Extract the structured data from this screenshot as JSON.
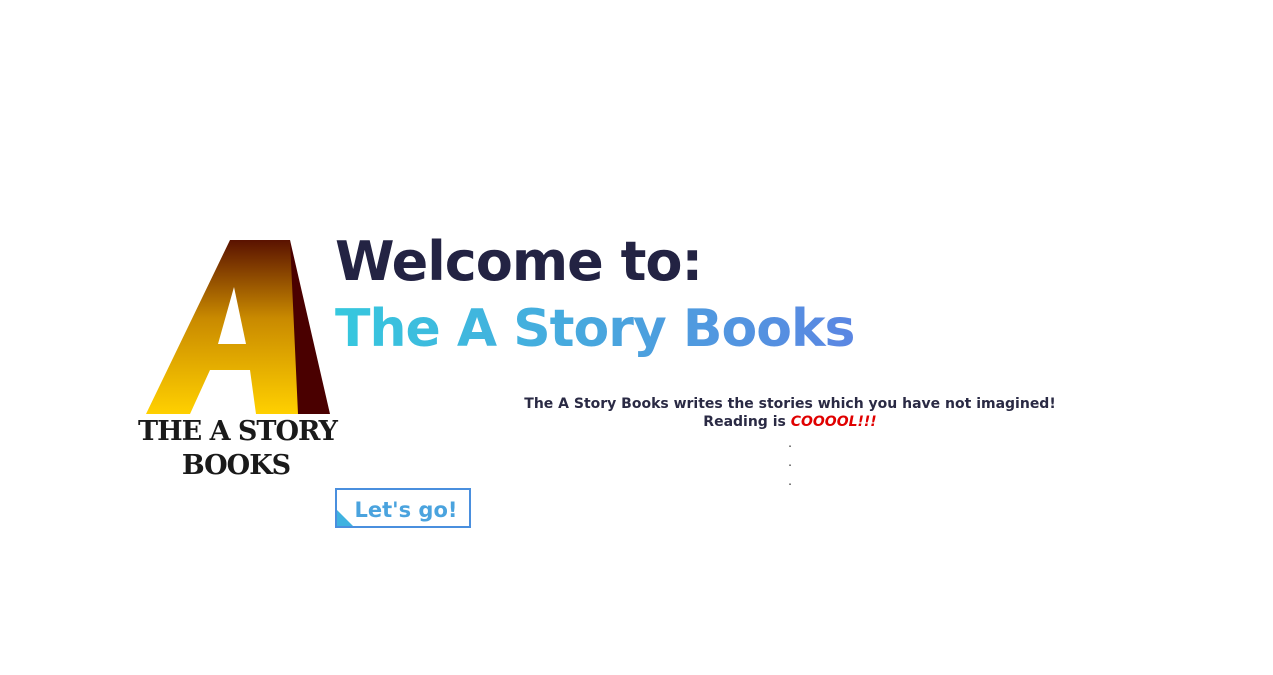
{
  "logo": {
    "line1": "THE A STORY",
    "line2": "BOOKS",
    "icon": "letter-a-logo",
    "colors": {
      "gold": "#f5c400",
      "dark_red": "#4a0000"
    }
  },
  "hero": {
    "welcome": "Welcome to:",
    "brand": "The A Story Books",
    "tagline_line1": "The A Story Books writes the stories which you have not imagined!",
    "tagline_line2_prefix": "Reading is ",
    "tagline_line2_emphasis": "COOOOL!!!",
    "dots": [
      ".",
      ".",
      "."
    ]
  },
  "cta": {
    "label": "Let's go!"
  },
  "colors": {
    "heading": "#232343",
    "brand_gradient_start": "#36c8de",
    "brand_gradient_end": "#5b86e2",
    "emphasis": "#e00000",
    "button_border": "#4a8fde"
  }
}
